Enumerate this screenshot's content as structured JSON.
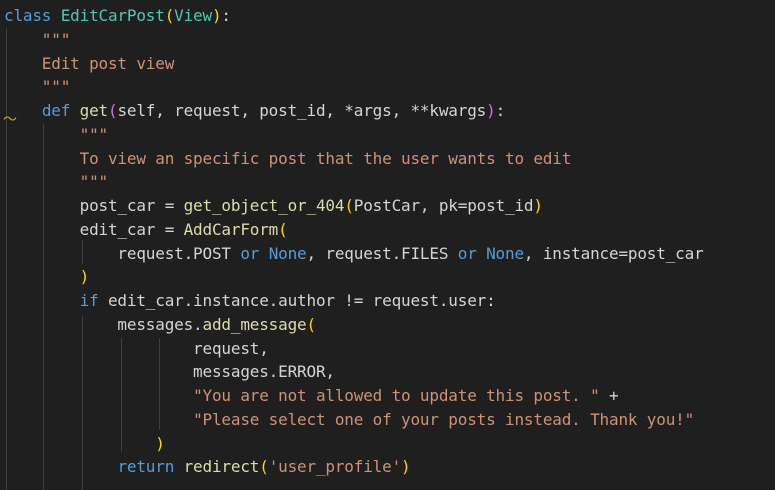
{
  "editor": {
    "background": "#1f1f1f",
    "colors": {
      "keyword": "#569cd6",
      "class": "#4ec9b0",
      "function": "#dcdcaa",
      "bracket_level1": "#ffd700",
      "bracket_level2": "#da70d6",
      "string": "#ce9178",
      "text": "#d4d4d4",
      "indent_guide": "#404040",
      "fold_marker": "#cca700"
    },
    "fold_marker_icon": "squiggle-warning-icon",
    "lines": [
      [
        {
          "t": "class",
          "c": "keyword"
        },
        {
          "t": " ",
          "c": "plain"
        },
        {
          "t": "EditCarPost",
          "c": "class"
        },
        {
          "t": "(",
          "c": "paren"
        },
        {
          "t": "View",
          "c": "class"
        },
        {
          "t": ")",
          "c": "paren"
        },
        {
          "t": ":",
          "c": "plain"
        }
      ],
      [
        {
          "t": "    \"\"\"",
          "c": "string"
        }
      ],
      [
        {
          "t": "    Edit post view",
          "c": "string"
        }
      ],
      [
        {
          "t": "    \"\"\"",
          "c": "string"
        }
      ],
      [
        {
          "t": "    ",
          "c": "plain"
        },
        {
          "t": "def",
          "c": "keyword"
        },
        {
          "t": " ",
          "c": "plain"
        },
        {
          "t": "get",
          "c": "func"
        },
        {
          "t": "(",
          "c": "paren2"
        },
        {
          "t": "self, request, post_id, *args, **kwargs",
          "c": "plain"
        },
        {
          "t": ")",
          "c": "paren2"
        },
        {
          "t": ":",
          "c": "plain"
        }
      ],
      [
        {
          "t": "        \"\"\"",
          "c": "string"
        }
      ],
      [
        {
          "t": "        To view an specific post that the user wants to edit",
          "c": "string"
        }
      ],
      [
        {
          "t": "        \"\"\"",
          "c": "string"
        }
      ],
      [
        {
          "t": "        post_car = ",
          "c": "plain"
        },
        {
          "t": "get_object_or_404",
          "c": "func"
        },
        {
          "t": "(",
          "c": "paren"
        },
        {
          "t": "PostCar, pk=post_id",
          "c": "plain"
        },
        {
          "t": ")",
          "c": "paren"
        }
      ],
      [
        {
          "t": "        edit_car = ",
          "c": "plain"
        },
        {
          "t": "AddCarForm",
          "c": "func"
        },
        {
          "t": "(",
          "c": "paren"
        }
      ],
      [
        {
          "t": "            request.POST ",
          "c": "plain"
        },
        {
          "t": "or",
          "c": "keyword"
        },
        {
          "t": " ",
          "c": "plain"
        },
        {
          "t": "None",
          "c": "const"
        },
        {
          "t": ", request.FILES ",
          "c": "plain"
        },
        {
          "t": "or",
          "c": "keyword"
        },
        {
          "t": " ",
          "c": "plain"
        },
        {
          "t": "None",
          "c": "const"
        },
        {
          "t": ", instance=post_car",
          "c": "plain"
        }
      ],
      [
        {
          "t": "        ",
          "c": "plain"
        },
        {
          "t": ")",
          "c": "paren"
        }
      ],
      [
        {
          "t": "        ",
          "c": "plain"
        },
        {
          "t": "if",
          "c": "keyword"
        },
        {
          "t": " edit_car.instance.author != request.user:",
          "c": "plain"
        }
      ],
      [
        {
          "t": "            messages.",
          "c": "plain"
        },
        {
          "t": "add_message",
          "c": "func"
        },
        {
          "t": "(",
          "c": "paren"
        }
      ],
      [
        {
          "t": "                    request,",
          "c": "plain"
        }
      ],
      [
        {
          "t": "                    messages.ERROR,",
          "c": "plain"
        }
      ],
      [
        {
          "t": "                    ",
          "c": "plain"
        },
        {
          "t": "\"You are not allowed to update this post. \"",
          "c": "string"
        },
        {
          "t": " +",
          "c": "plain"
        }
      ],
      [
        {
          "t": "                    ",
          "c": "plain"
        },
        {
          "t": "\"Please select one of your posts instead. Thank you!\"",
          "c": "string"
        }
      ],
      [
        {
          "t": "                ",
          "c": "plain"
        },
        {
          "t": ")",
          "c": "paren"
        }
      ],
      [
        {
          "t": "            ",
          "c": "plain"
        },
        {
          "t": "return",
          "c": "keyword"
        },
        {
          "t": " ",
          "c": "plain"
        },
        {
          "t": "redirect",
          "c": "func"
        },
        {
          "t": "(",
          "c": "paren"
        },
        {
          "t": "'user_profile'",
          "c": "string"
        },
        {
          "t": ")",
          "c": "paren"
        }
      ]
    ]
  }
}
